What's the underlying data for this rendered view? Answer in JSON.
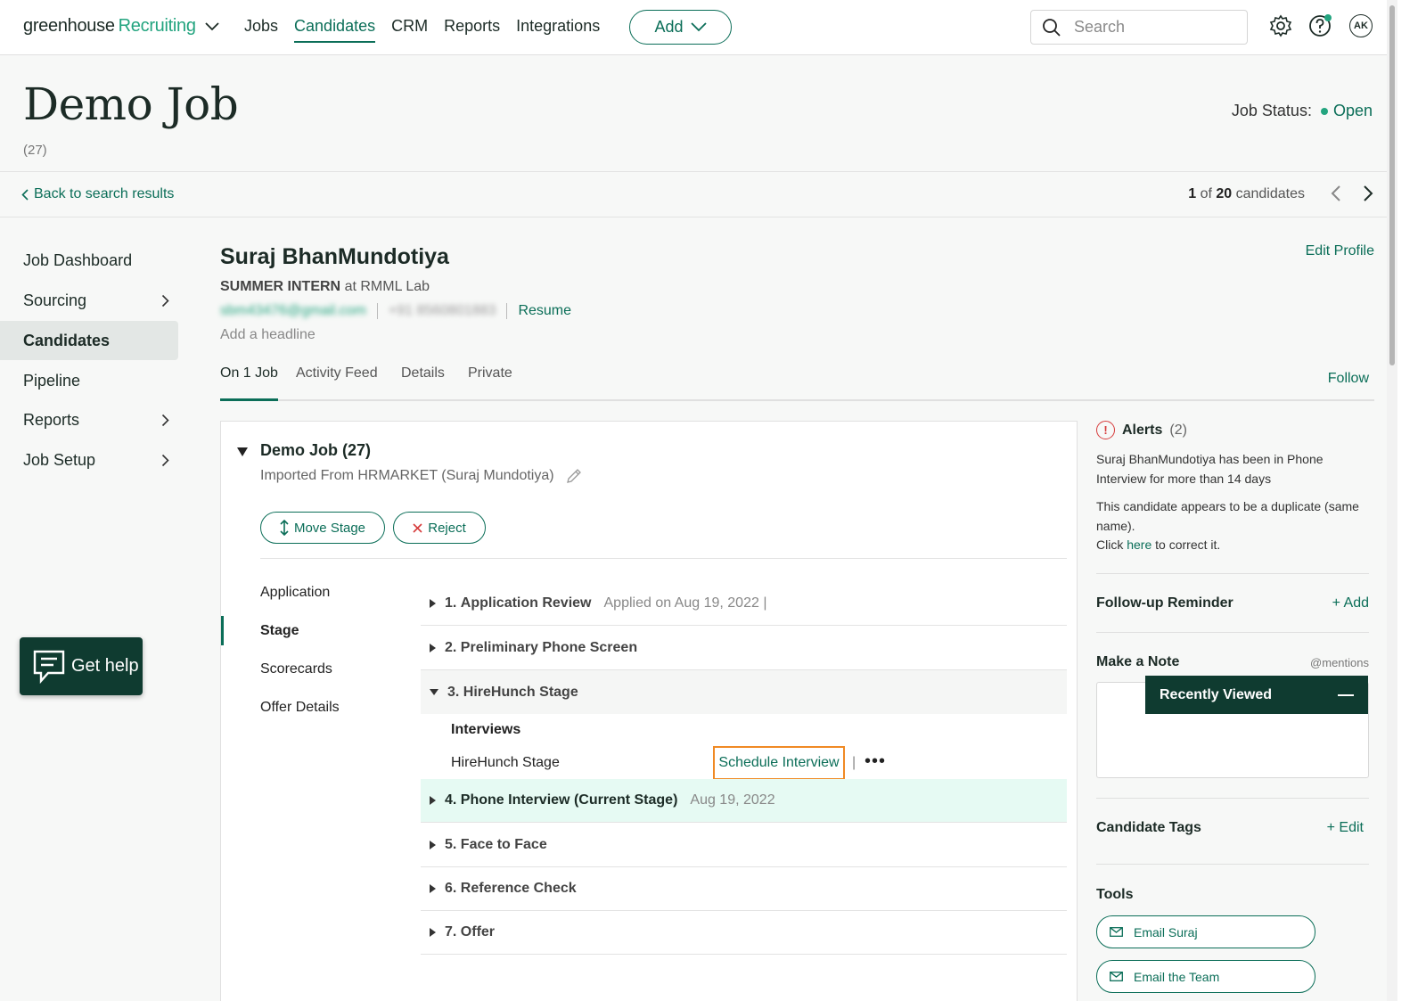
{
  "brand": {
    "primary": "greenhouse",
    "secondary": "Recruiting",
    "accent": "#0b6e58"
  },
  "nav": {
    "items": [
      "Jobs",
      "Candidates",
      "CRM",
      "Reports",
      "Integrations"
    ],
    "active": "Candidates",
    "add_label": "Add"
  },
  "search": {
    "placeholder": "Search"
  },
  "user": {
    "initials": "AK"
  },
  "job": {
    "title": "Demo Job",
    "count": "(27)",
    "status_label": "Job Status:",
    "status_value": "Open"
  },
  "subbar": {
    "back_label": "Back to search results",
    "pos": "1",
    "of": "of",
    "total": "20",
    "suffix": "candidates"
  },
  "sidebar": {
    "items": [
      {
        "label": "Job Dashboard"
      },
      {
        "label": "Sourcing"
      },
      {
        "label": "Candidates"
      },
      {
        "label": "Pipeline"
      },
      {
        "label": "Reports"
      },
      {
        "label": "Job Setup"
      }
    ]
  },
  "help": {
    "label": "Get help"
  },
  "candidate": {
    "name": "Suraj BhanMundotiya",
    "role": "SUMMER INTERN",
    "company": "at RMML Lab",
    "email": "sbm43476@gmail.com",
    "phone": "+91 8560801883",
    "resume": "Resume",
    "headline_placeholder": "Add a headline",
    "edit_profile": "Edit Profile"
  },
  "tabs": {
    "items": [
      "On 1 Job",
      "Activity Feed",
      "Details",
      "Private"
    ],
    "follow": "Follow"
  },
  "jobpanel": {
    "title": "Demo Job (27)",
    "imported": "Imported From HRMARKET (Suraj Mundotiya)",
    "move_stage": "Move Stage",
    "reject": "Reject",
    "nav": [
      "Application",
      "Stage",
      "Scorecards",
      "Offer Details"
    ],
    "stages": [
      {
        "num": "1.",
        "name": "Application Review",
        "meta": "Applied on Aug 19, 2022 |"
      },
      {
        "num": "2.",
        "name": "Preliminary Phone Screen",
        "meta": ""
      },
      {
        "num": "3.",
        "name": "HireHunch Stage",
        "meta": ""
      },
      {
        "num": "4.",
        "name": "Phone Interview (Current Stage)",
        "meta": "Aug 19, 2022"
      },
      {
        "num": "5.",
        "name": "Face to Face",
        "meta": ""
      },
      {
        "num": "6.",
        "name": "Reference Check",
        "meta": ""
      },
      {
        "num": "7.",
        "name": "Offer",
        "meta": ""
      }
    ],
    "interviews_label": "Interviews",
    "interview_name": "HireHunch Stage",
    "schedule": "Schedule Interview",
    "pipe": "|",
    "more": "•••"
  },
  "right": {
    "alerts_title": "Alerts",
    "alerts_count": "(2)",
    "alert1": "Suraj BhanMundotiya has been in Phone Interview for more than 14 days",
    "alert2": "This candidate appears to be a duplicate (same name).",
    "alert3_pre": "Click",
    "alert3_link": "here",
    "alert3_post": "to correct it.",
    "followup": "Follow-up Reminder",
    "followup_add": "+ Add",
    "note": "Make a Note",
    "mentions": "@mentions",
    "recent": "Recently Viewed",
    "tags": "Candidate Tags",
    "tags_edit": "+ Edit",
    "tools": "Tools",
    "email_candidate": "Email Suraj",
    "email_team": "Email the Team"
  }
}
